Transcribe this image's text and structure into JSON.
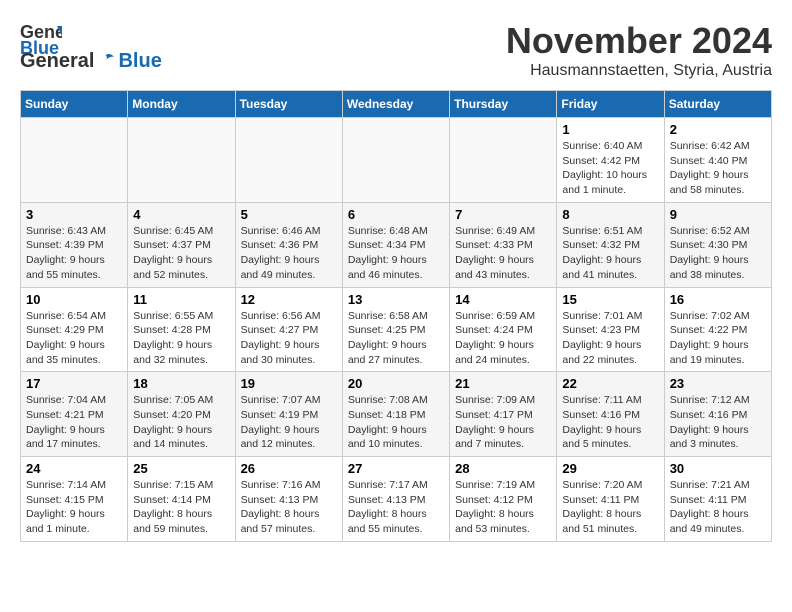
{
  "header": {
    "logo_general": "General",
    "logo_blue": "Blue",
    "month_title": "November 2024",
    "location": "Hausmannstaetten, Styria, Austria"
  },
  "weekdays": [
    "Sunday",
    "Monday",
    "Tuesday",
    "Wednesday",
    "Thursday",
    "Friday",
    "Saturday"
  ],
  "weeks": [
    [
      {
        "day": "",
        "info": ""
      },
      {
        "day": "",
        "info": ""
      },
      {
        "day": "",
        "info": ""
      },
      {
        "day": "",
        "info": ""
      },
      {
        "day": "",
        "info": ""
      },
      {
        "day": "1",
        "info": "Sunrise: 6:40 AM\nSunset: 4:42 PM\nDaylight: 10 hours\nand 1 minute."
      },
      {
        "day": "2",
        "info": "Sunrise: 6:42 AM\nSunset: 4:40 PM\nDaylight: 9 hours\nand 58 minutes."
      }
    ],
    [
      {
        "day": "3",
        "info": "Sunrise: 6:43 AM\nSunset: 4:39 PM\nDaylight: 9 hours\nand 55 minutes."
      },
      {
        "day": "4",
        "info": "Sunrise: 6:45 AM\nSunset: 4:37 PM\nDaylight: 9 hours\nand 52 minutes."
      },
      {
        "day": "5",
        "info": "Sunrise: 6:46 AM\nSunset: 4:36 PM\nDaylight: 9 hours\nand 49 minutes."
      },
      {
        "day": "6",
        "info": "Sunrise: 6:48 AM\nSunset: 4:34 PM\nDaylight: 9 hours\nand 46 minutes."
      },
      {
        "day": "7",
        "info": "Sunrise: 6:49 AM\nSunset: 4:33 PM\nDaylight: 9 hours\nand 43 minutes."
      },
      {
        "day": "8",
        "info": "Sunrise: 6:51 AM\nSunset: 4:32 PM\nDaylight: 9 hours\nand 41 minutes."
      },
      {
        "day": "9",
        "info": "Sunrise: 6:52 AM\nSunset: 4:30 PM\nDaylight: 9 hours\nand 38 minutes."
      }
    ],
    [
      {
        "day": "10",
        "info": "Sunrise: 6:54 AM\nSunset: 4:29 PM\nDaylight: 9 hours\nand 35 minutes."
      },
      {
        "day": "11",
        "info": "Sunrise: 6:55 AM\nSunset: 4:28 PM\nDaylight: 9 hours\nand 32 minutes."
      },
      {
        "day": "12",
        "info": "Sunrise: 6:56 AM\nSunset: 4:27 PM\nDaylight: 9 hours\nand 30 minutes."
      },
      {
        "day": "13",
        "info": "Sunrise: 6:58 AM\nSunset: 4:25 PM\nDaylight: 9 hours\nand 27 minutes."
      },
      {
        "day": "14",
        "info": "Sunrise: 6:59 AM\nSunset: 4:24 PM\nDaylight: 9 hours\nand 24 minutes."
      },
      {
        "day": "15",
        "info": "Sunrise: 7:01 AM\nSunset: 4:23 PM\nDaylight: 9 hours\nand 22 minutes."
      },
      {
        "day": "16",
        "info": "Sunrise: 7:02 AM\nSunset: 4:22 PM\nDaylight: 9 hours\nand 19 minutes."
      }
    ],
    [
      {
        "day": "17",
        "info": "Sunrise: 7:04 AM\nSunset: 4:21 PM\nDaylight: 9 hours\nand 17 minutes."
      },
      {
        "day": "18",
        "info": "Sunrise: 7:05 AM\nSunset: 4:20 PM\nDaylight: 9 hours\nand 14 minutes."
      },
      {
        "day": "19",
        "info": "Sunrise: 7:07 AM\nSunset: 4:19 PM\nDaylight: 9 hours\nand 12 minutes."
      },
      {
        "day": "20",
        "info": "Sunrise: 7:08 AM\nSunset: 4:18 PM\nDaylight: 9 hours\nand 10 minutes."
      },
      {
        "day": "21",
        "info": "Sunrise: 7:09 AM\nSunset: 4:17 PM\nDaylight: 9 hours\nand 7 minutes."
      },
      {
        "day": "22",
        "info": "Sunrise: 7:11 AM\nSunset: 4:16 PM\nDaylight: 9 hours\nand 5 minutes."
      },
      {
        "day": "23",
        "info": "Sunrise: 7:12 AM\nSunset: 4:16 PM\nDaylight: 9 hours\nand 3 minutes."
      }
    ],
    [
      {
        "day": "24",
        "info": "Sunrise: 7:14 AM\nSunset: 4:15 PM\nDaylight: 9 hours\nand 1 minute."
      },
      {
        "day": "25",
        "info": "Sunrise: 7:15 AM\nSunset: 4:14 PM\nDaylight: 8 hours\nand 59 minutes."
      },
      {
        "day": "26",
        "info": "Sunrise: 7:16 AM\nSunset: 4:13 PM\nDaylight: 8 hours\nand 57 minutes."
      },
      {
        "day": "27",
        "info": "Sunrise: 7:17 AM\nSunset: 4:13 PM\nDaylight: 8 hours\nand 55 minutes."
      },
      {
        "day": "28",
        "info": "Sunrise: 7:19 AM\nSunset: 4:12 PM\nDaylight: 8 hours\nand 53 minutes."
      },
      {
        "day": "29",
        "info": "Sunrise: 7:20 AM\nSunset: 4:11 PM\nDaylight: 8 hours\nand 51 minutes."
      },
      {
        "day": "30",
        "info": "Sunrise: 7:21 AM\nSunset: 4:11 PM\nDaylight: 8 hours\nand 49 minutes."
      }
    ]
  ]
}
